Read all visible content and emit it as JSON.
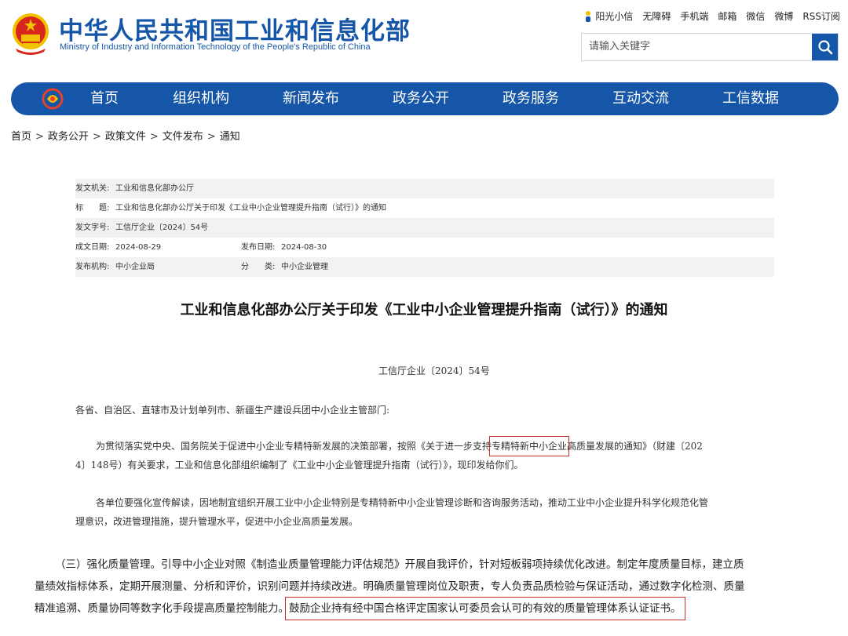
{
  "header": {
    "title": "中华人民共和国工业和信息化部",
    "subtitle": "Ministry of Industry and Information Technology of the People's Republic of China",
    "toplinks": [
      "阳光小信",
      "无障碍",
      "手机端",
      "邮箱",
      "微信",
      "微博",
      "RSS订阅"
    ],
    "search_placeholder": "请输入关键字"
  },
  "nav": {
    "items": [
      "首页",
      "组织机构",
      "新闻发布",
      "政务公开",
      "政务服务",
      "互动交流",
      "工信数据"
    ]
  },
  "breadcrumb": [
    "首页",
    "政务公开",
    "政策文件",
    "文件发布",
    "通知"
  ],
  "meta": {
    "issuer_label": "发文机关:",
    "issuer": "工业和信息化部办公厅",
    "title_label": "标　　题:",
    "title": "工业和信息化部办公厅关于印发《工业中小企业管理提升指南（试行）》的通知",
    "docno_label": "发文字号:",
    "docno": "工信厅企业〔2024〕54号",
    "created_label": "成文日期:",
    "created": "2024-08-29",
    "published_label": "发布日期:",
    "published": "2024-08-30",
    "org_label": "发布机构:",
    "org": "中小企业局",
    "category_label": "分　　类:",
    "category": "中小企业管理"
  },
  "document": {
    "title": "工业和信息化部办公厅关于印发《工业中小企业管理提升指南（试行）》的通知",
    "number": "工信厅企业〔2024〕54号",
    "salutation": "各省、自治区、直辖市及计划单列市、新疆生产建设兵团中小企业主管部门:",
    "p1_a": "为贯彻落实党中央、国务院关于促进中小企业专精特新发展的决策部署，按照《关于进一步支持",
    "p1_hl": "专精特新中小企业",
    "p1_b": "高质量发展的通知》（财建〔202",
    "p1_line2": "4〕148号）有关要求，工业和信息化部组织编制了《工业中小企业管理提升指南（试行）》，现印发给你们。",
    "p2_line1": "各单位要强化宣传解读，因地制宜组织开展工业中小企业特别是专精特新中小企业管理诊断和咨询服务活动，推动工业中小企业提升科学化规范化管",
    "p2_line2": "理意识，改进管理措施，提升管理水平，促进中小企业高质量发展。"
  },
  "excerpt": {
    "line1": "（三）强化质量管理。引导中小企业对照《制造业质量管理能力评估规范》开展自我评价，针对短板弱项持续优化改进。制定年度质量目标，建立质",
    "line2": "量绩效指标体系，定期开展测量、分析和评价，识别问题并持续改进。明确质量管理岗位及职责，专人负责品质检验与保证活动，通过数字化检测、质量",
    "line3_a": "精准追溯、质量协同等数字化手段提高质量控制能力。",
    "line3_hl": "鼓励企业持有经中国合格评定国家认可委员会认可的有效的质量管理体系认证证书。"
  },
  "colors": {
    "brand_blue": "#1556a8",
    "highlight_red": "#c8322c",
    "emblem_red": "#d8261c",
    "emblem_gold": "#f2c200"
  }
}
